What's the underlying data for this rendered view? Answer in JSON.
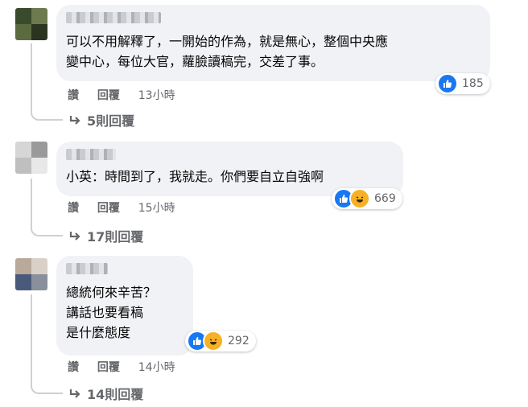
{
  "comments": [
    {
      "text": "可以不用解釋了，一開始的作為，就是無心，整個中央應\n變中心，每位大官，蘿臉讀稿完，交差了事。",
      "actions": {
        "like": "讚",
        "reply": "回覆",
        "time": "13小時"
      },
      "reaction_count": "185",
      "reaction_icons": [
        "like-icon"
      ],
      "replies_label": "5則回覆"
    },
    {
      "text": "小英：時間到了，我就走。你們要自立自強啊",
      "actions": {
        "like": "讚",
        "reply": "回覆",
        "time": "15小時"
      },
      "reaction_count": "669",
      "reaction_icons": [
        "like-icon",
        "haha-icon"
      ],
      "replies_label": "17則回覆"
    },
    {
      "text": "總統何來辛苦？\n講話也要看稿\n是什麼態度",
      "actions": {
        "like": "讚",
        "reply": "回覆",
        "time": "14小時"
      },
      "reaction_count": "292",
      "reaction_icons": [
        "like-icon",
        "haha-icon"
      ],
      "replies_label": "14則回覆"
    }
  ],
  "colors": {
    "bubble": "#f0f2f5",
    "like": "#1877f2",
    "haha": "#f7b125",
    "muted": "#65676b"
  }
}
